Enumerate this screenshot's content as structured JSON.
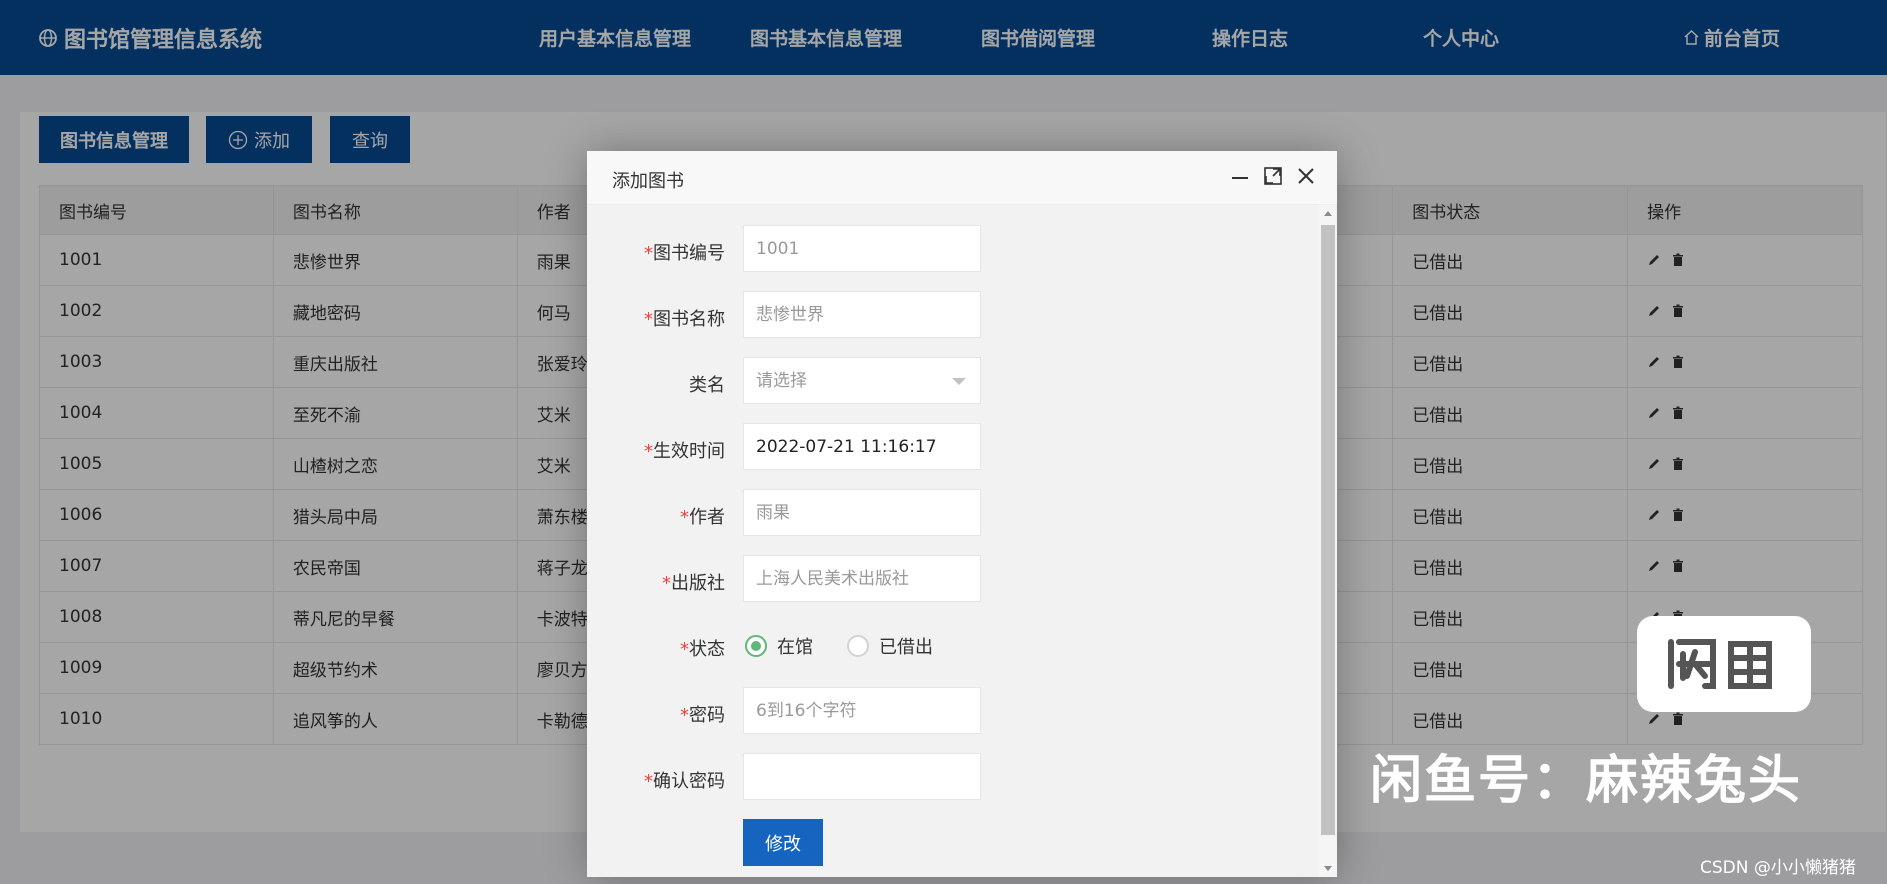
{
  "header": {
    "brand": "图书馆管理信息系统",
    "nav": [
      "用户基本信息管理",
      "图书基本信息管理",
      "图书借阅管理",
      "操作日志",
      "个人中心"
    ],
    "home": "前台首页"
  },
  "toolbar": {
    "manage_label": "图书信息管理",
    "add_label": "添加",
    "query_label": "查询"
  },
  "table": {
    "columns": [
      "图书编号",
      "图书名称",
      "作者",
      "图书状态",
      "操作"
    ],
    "rows": [
      {
        "id": "1001",
        "name": "悲惨世界",
        "author": "雨果",
        "status": "已借出"
      },
      {
        "id": "1002",
        "name": "藏地密码",
        "author": "何马",
        "status": "已借出"
      },
      {
        "id": "1003",
        "name": "重庆出版社",
        "author": "张爱玲",
        "status": "已借出"
      },
      {
        "id": "1004",
        "name": "至死不渝",
        "author": "艾米",
        "status": "已借出"
      },
      {
        "id": "1005",
        "name": "山楂树之恋",
        "author": "艾米",
        "status": "已借出"
      },
      {
        "id": "1006",
        "name": "猎头局中局",
        "author": "萧东楼",
        "status": "已借出"
      },
      {
        "id": "1007",
        "name": "农民帝国",
        "author": "蒋子龙",
        "status": "已借出"
      },
      {
        "id": "1008",
        "name": "蒂凡尼的早餐",
        "author": "卡波特",
        "status": "已借出"
      },
      {
        "id": "1009",
        "name": "超级节约术",
        "author": "廖贝方",
        "status": "已借出"
      },
      {
        "id": "1010",
        "name": "追风筝的人",
        "author": "卡勒德",
        "status": "已借出"
      }
    ]
  },
  "dialog": {
    "title": "添加图书",
    "fields": {
      "book_no": {
        "label": "图书编号",
        "placeholder": "1001"
      },
      "book_name": {
        "label": "图书名称",
        "placeholder": "悲惨世界"
      },
      "category": {
        "label": "类名",
        "placeholder": "请选择"
      },
      "effective_time": {
        "label": "生效时间",
        "value": "2022-07-21 11:16:17"
      },
      "author": {
        "label": "作者",
        "placeholder": "雨果"
      },
      "publisher": {
        "label": "出版社",
        "placeholder": "上海人民美术出版社"
      },
      "status": {
        "label": "状态",
        "options": [
          "在馆",
          "已借出"
        ],
        "selected": "在馆"
      },
      "password": {
        "label": "密码",
        "placeholder": "6到16个字符"
      },
      "confirm_password": {
        "label": "确认密码",
        "placeholder": ""
      }
    },
    "submit_label": "修改"
  },
  "watermark": {
    "logo_text": "闲鱼",
    "text": "闲鱼号：麻辣兔头",
    "csdn": "CSDN @小小懒猪猪"
  },
  "colors": {
    "topbar": "#054b93",
    "accent": "#1565c0",
    "radio_on": "#5fb878"
  }
}
